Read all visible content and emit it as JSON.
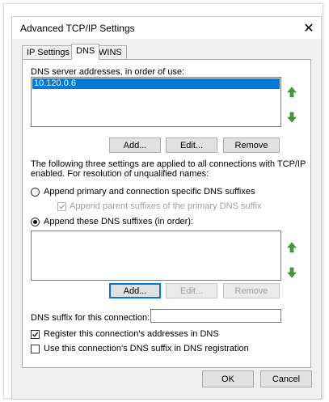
{
  "window": {
    "title": "Advanced TCP/IP Settings",
    "close_glyph": "✕"
  },
  "tabs": [
    {
      "label": "IP Settings",
      "active": false
    },
    {
      "label": "DNS",
      "active": true
    },
    {
      "label": "WINS",
      "active": false
    }
  ],
  "dns": {
    "servers_label": "DNS server addresses, in order of use:",
    "servers": [
      "10.120.0.6"
    ],
    "buttons": {
      "add": "Add...",
      "edit": "Edit...",
      "remove": "Remove"
    },
    "description_line1": "The following three settings are applied to all connections with TCP/IP",
    "description_line2": "enabled. For resolution of unqualified names:",
    "radio_primary": {
      "label": "Append primary and connection specific DNS suffixes",
      "checked": false
    },
    "check_parent": {
      "label": "Append parent suffixes of the primary DNS suffix",
      "checked": true,
      "disabled": true
    },
    "radio_these": {
      "label": "Append these DNS suffixes (in order):",
      "checked": true
    },
    "suffixes": [],
    "suffix_buttons": {
      "add": "Add...",
      "edit": "Edit...",
      "remove": "Remove"
    },
    "connection_suffix_label": "DNS suffix for this connection:",
    "connection_suffix_value": "",
    "register_check": {
      "label": "Register this connection's addresses in DNS",
      "checked": true
    },
    "use_suffix_check": {
      "label": "Use this connection's DNS suffix in DNS registration",
      "checked": false
    }
  },
  "footer": {
    "ok": "OK",
    "cancel": "Cancel"
  },
  "colors": {
    "accent": "#0078d7",
    "arrow_green": "#3f9b3f"
  },
  "icons": {
    "move_up": "arrow-up-icon",
    "move_down": "arrow-down-icon",
    "close": "close-icon"
  }
}
